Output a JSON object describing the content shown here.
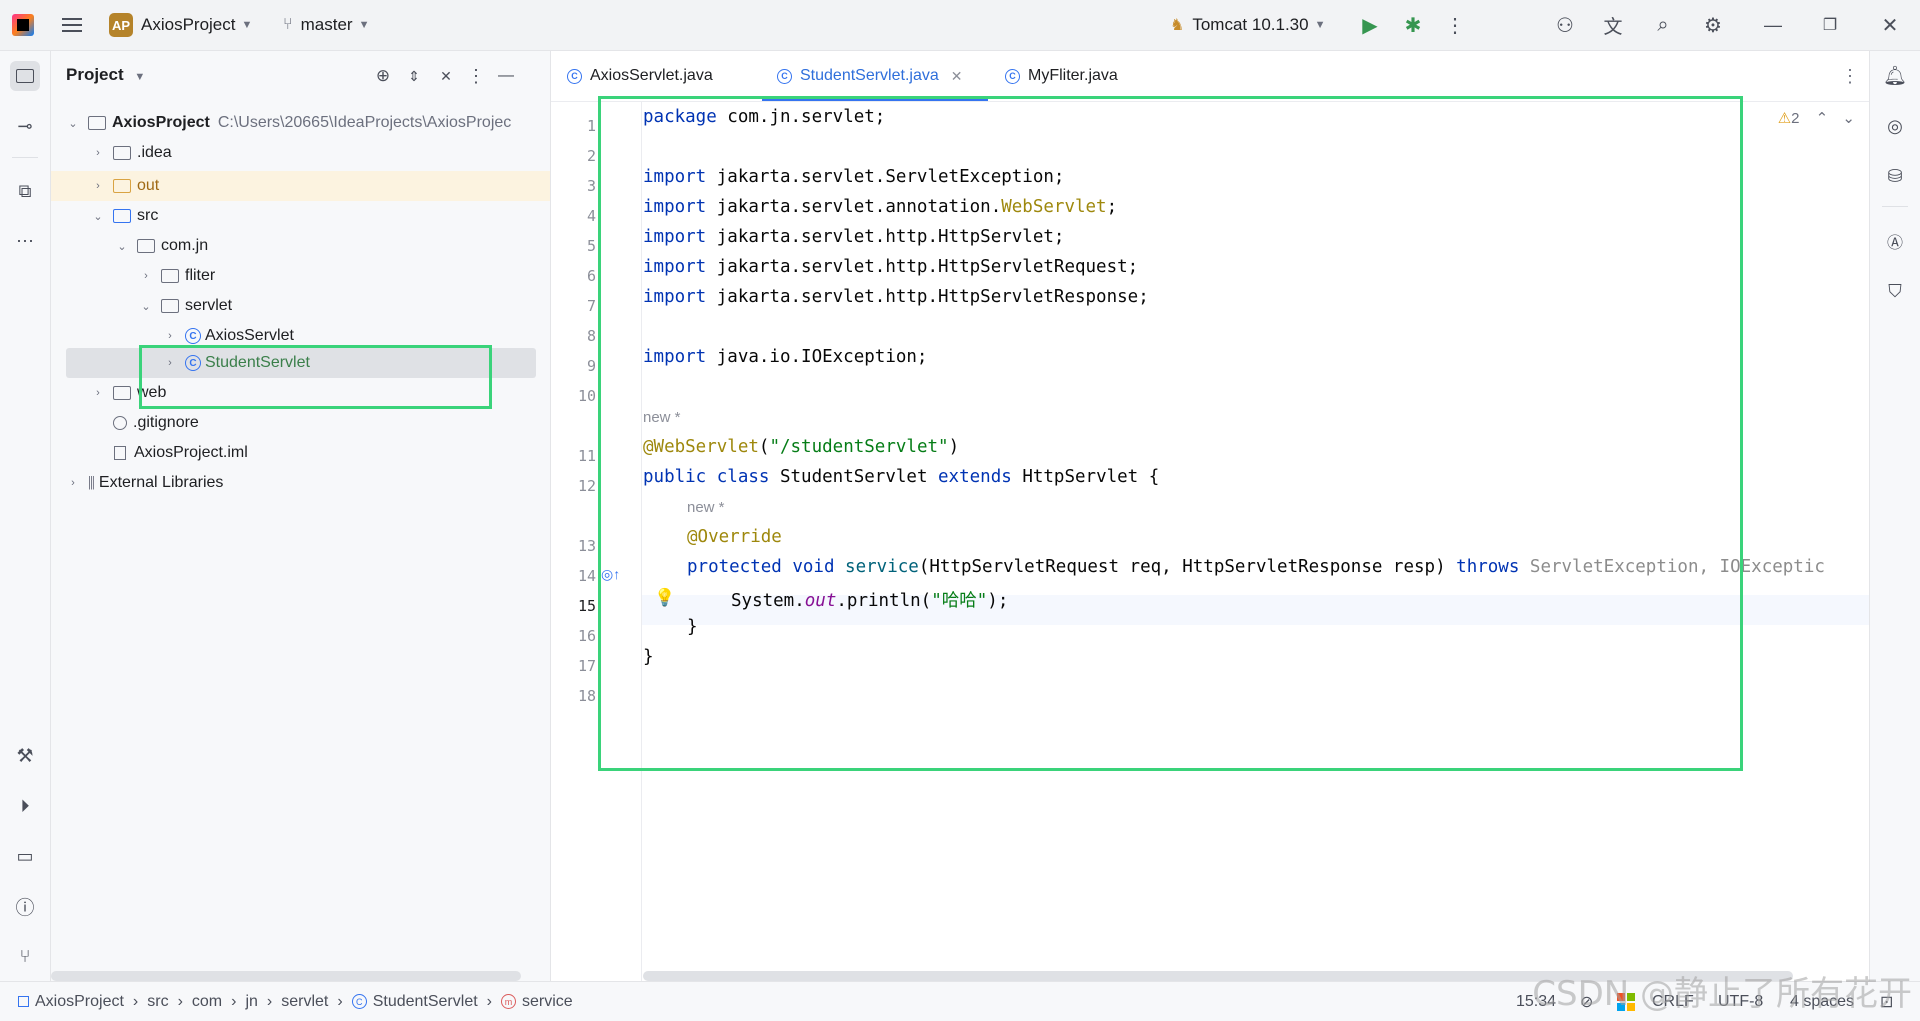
{
  "topbar": {
    "project_badge": "AP",
    "project_name": "AxiosProject",
    "branch": "master",
    "run_config": "Tomcat 10.1.30"
  },
  "project_panel": {
    "title": "Project",
    "tree": [
      {
        "label": "AxiosProject",
        "extra": "C:\\Users\\20665\\IdeaProjects\\AxiosProjec"
      },
      {
        "label": ".idea"
      },
      {
        "label": "out"
      },
      {
        "label": "src"
      },
      {
        "label": "com.jn"
      },
      {
        "label": "fliter"
      },
      {
        "label": "servlet"
      },
      {
        "label": "AxiosServlet"
      },
      {
        "label": "StudentServlet"
      },
      {
        "label": "web"
      },
      {
        "label": ".gitignore"
      },
      {
        "label": "AxiosProject.iml"
      },
      {
        "label": "External Libraries"
      }
    ]
  },
  "tabs": [
    {
      "label": "AxiosServlet.java"
    },
    {
      "label": "StudentServlet.java"
    },
    {
      "label": "MyFliter.java"
    }
  ],
  "editor": {
    "warnings": "2",
    "line_numbers": [
      "1",
      "2",
      "3",
      "4",
      "5",
      "6",
      "7",
      "8",
      "9",
      "10",
      "11",
      "12",
      "13",
      "14",
      "15",
      "16",
      "17",
      "18"
    ],
    "hints": {
      "h1": "new *",
      "h2": "new *"
    },
    "code": {
      "l1_kw": "package",
      "l1_rest": " com.jn.servlet;",
      "l3_kw": "import",
      "l3_rest": " jakarta.servlet.ServletException;",
      "l4_kw": "import",
      "l4_rest": " jakarta.servlet.annotation.",
      "l4_ann": "WebServlet",
      "l4_end": ";",
      "l5_kw": "import",
      "l5_rest": " jakarta.servlet.http.HttpServlet;",
      "l6_kw": "import",
      "l6_rest": " jakarta.servlet.http.HttpServletRequest;",
      "l7_kw": "import",
      "l7_rest": " jakarta.servlet.http.HttpServletResponse;",
      "l9_kw": "import",
      "l9_rest": " java.io.IOException;",
      "l11_ann": "@WebServlet",
      "l11_p1": "(",
      "l11_str": "\"/studentServlet\"",
      "l11_p2": ")",
      "l12_kw1": "public class",
      "l12_name": " StudentServlet ",
      "l12_kw2": "extends",
      "l12_rest": " HttpServlet {",
      "l13_ann": "@Override",
      "l14_kw": "protected void",
      "l14_m": " service",
      "l14_args": "(HttpServletRequest req, HttpServletResponse resp) ",
      "l14_throws": "throws",
      "l14_ex": " ServletException, IOExceptic",
      "l15_a": "System.",
      "l15_fld": "out",
      "l15_b": ".println(",
      "l15_str": "\"哈哈\"",
      "l15_c": ");",
      "l16": "}",
      "l17": "}"
    }
  },
  "statusbar": {
    "breadcrumbs": [
      "AxiosProject",
      "src",
      "com",
      "jn",
      "servlet",
      "StudentServlet",
      "service"
    ],
    "position": "15:34",
    "line_sep": "CRLF",
    "encoding": "UTF-8",
    "indent": "4 spaces"
  },
  "watermark": "CSDN @静止了所有花开",
  "colors": {
    "highlight": "#3ad37a",
    "accent": "#3574f0"
  }
}
